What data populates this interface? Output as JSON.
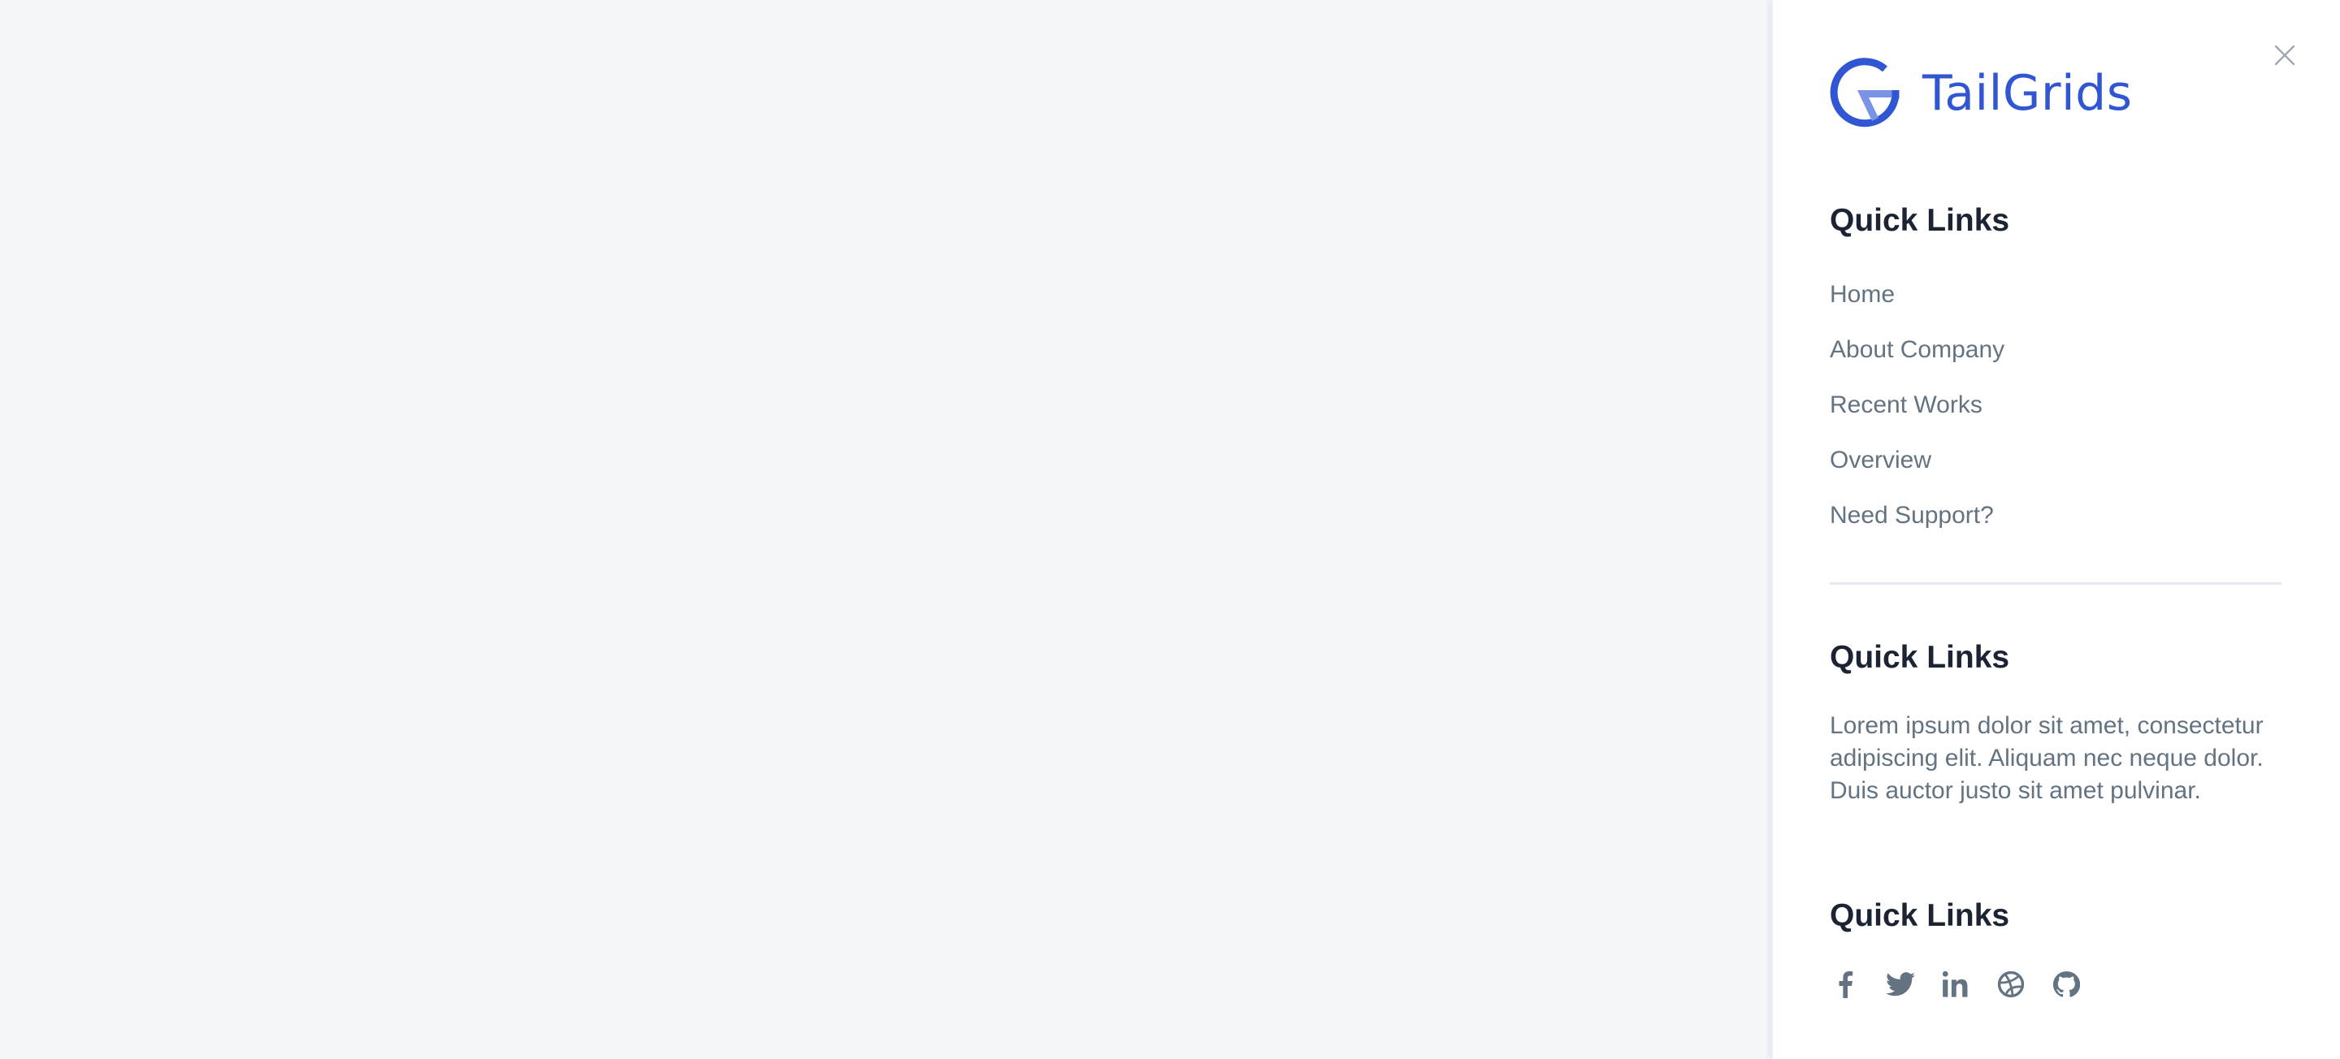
{
  "brand": {
    "name": "TailGrids",
    "color": "#3056d3",
    "color_light": "#7b93e6"
  },
  "drawer": {
    "close_label": "Close",
    "sections": [
      {
        "title": "Quick Links",
        "links": [
          "Home",
          "About Company",
          "Recent Works",
          "Overview",
          "Need Support?"
        ]
      },
      {
        "title": "Quick Links",
        "text": "Lorem ipsum dolor sit amet, consectetur adipiscing elit. Aliquam nec neque dolor. Duis auctor justo sit amet pulvinar."
      },
      {
        "title": "Quick Links",
        "socials": [
          {
            "name": "facebook",
            "icon": "facebook-icon"
          },
          {
            "name": "twitter",
            "icon": "twitter-icon"
          },
          {
            "name": "linkedin",
            "icon": "linkedin-icon"
          },
          {
            "name": "dribbble",
            "icon": "dribbble-icon"
          },
          {
            "name": "github",
            "icon": "github-icon"
          }
        ]
      }
    ]
  },
  "colors": {
    "page_background": "#f4f8fb",
    "panel_background": "#ffffff",
    "heading": "#1c2434",
    "body_text": "#637381",
    "divider": "#e8e9ec",
    "close_icon": "#a0a7b1"
  }
}
